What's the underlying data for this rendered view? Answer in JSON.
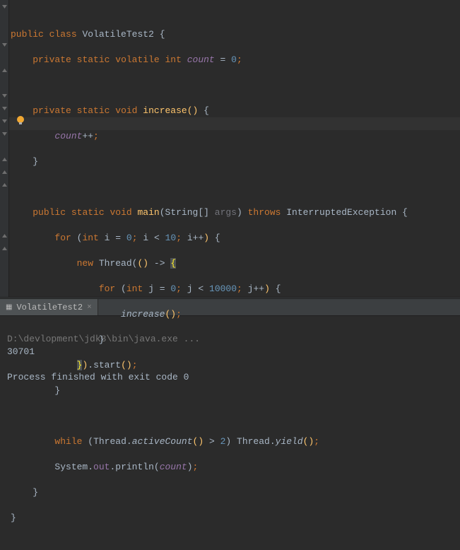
{
  "code": {
    "l1": {
      "public": "public",
      "class": "class",
      "name": "VolatileTest2",
      "brace": "{"
    },
    "l2": {
      "private": "private",
      "static": "static",
      "volatile": "volatile",
      "int": "int",
      "field": "count",
      "eq": "=",
      "zero": "0",
      "semi": ";"
    },
    "l4": {
      "private": "private",
      "static": "static",
      "void": "void",
      "method": "increase",
      "lp": "(",
      "rp": ")",
      "brace": "{"
    },
    "l5": {
      "field": "count",
      "inc": "++",
      "semi": ";"
    },
    "l6": {
      "brace": "}"
    },
    "l8": {
      "public": "public",
      "static": "static",
      "void": "void",
      "main": "main",
      "lp": "(",
      "string": "String",
      "br": "[]",
      "args": "args",
      "rp": ")",
      "throws": "throws",
      "exc": "InterruptedException",
      "brace": "{"
    },
    "l9": {
      "for": "for",
      "lp": "(",
      "int": "int",
      "i": "i",
      "eq": "=",
      "zero": "0",
      "semi1": ";",
      "i2": "i",
      "lt": "<",
      "ten": "10",
      "semi2": ";",
      "i3": "i",
      "inc": "++",
      "rp": ")",
      "brace": "{"
    },
    "l10": {
      "new": "new",
      "thread": "Thread",
      "lp": "(",
      "lp2": "(",
      "rp2": ")",
      "arrow": "->",
      "brace": "{"
    },
    "l11": {
      "for": "for",
      "lp": "(",
      "int": "int",
      "j": "j",
      "eq": "=",
      "zero": "0",
      "semi1": ";",
      "j2": "j",
      "lt": "<",
      "tenk": "10000",
      "semi2": ";",
      "j3": "j",
      "inc": "++",
      "rp": ")",
      "brace": "{"
    },
    "l12": {
      "method": "increase",
      "lp": "(",
      "rp": ")",
      "semi": ";"
    },
    "l13": {
      "brace": "}"
    },
    "l14": {
      "brace": "}",
      "rp": ")",
      "dot": ".",
      "start": "start",
      "lp": "(",
      "rp2": ")",
      "semi": ";"
    },
    "l15": {
      "brace": "}"
    },
    "l17": {
      "while": "while",
      "lp": "(",
      "thread": "Thread",
      "dot": ".",
      "ac": "activeCount",
      "lp2": "(",
      "rp2": ")",
      "gt": ">",
      "two": "2",
      "rp": ")",
      "thread2": "Thread",
      "dot2": ".",
      "yield": "yield",
      "lp3": "(",
      "rp3": ")",
      "semi": ";"
    },
    "l18": {
      "system": "System",
      "dot": ".",
      "out": "out",
      "dot2": ".",
      "println": "println",
      "lp": "(",
      "count": "count",
      "rp": ")",
      "semi": ";"
    },
    "l19": {
      "brace": "}"
    },
    "l20": {
      "brace": "}"
    }
  },
  "tab": {
    "name": "VolatileTest2",
    "close": "×"
  },
  "console": {
    "path": "D:\\devlopment\\jdk8\\bin\\java.exe ...",
    "output": "30701",
    "blank": "",
    "exit": "Process finished with exit code 0"
  }
}
